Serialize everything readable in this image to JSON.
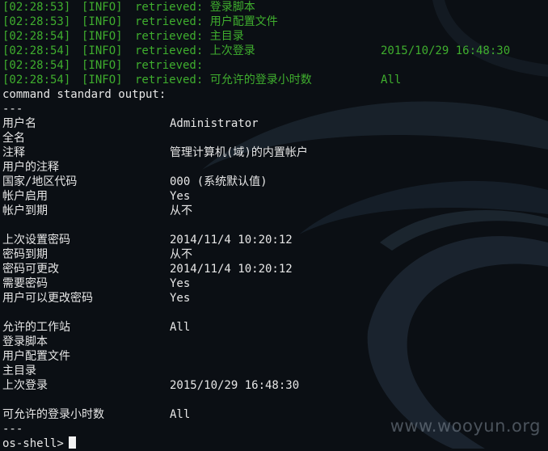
{
  "log_lines": [
    {
      "ts": "[02:28:53]",
      "level": "[INFO]",
      "msg": "retrieved: 登录脚本",
      "extra": ""
    },
    {
      "ts": "[02:28:53]",
      "level": "[INFO]",
      "msg": "retrieved: 用户配置文件",
      "extra": ""
    },
    {
      "ts": "[02:28:54]",
      "level": "[INFO]",
      "msg": "retrieved: 主目录",
      "extra": ""
    },
    {
      "ts": "[02:28:54]",
      "level": "[INFO]",
      "msg": "retrieved: 上次登录",
      "extra": "2015/10/29 16:48:30"
    },
    {
      "ts": "[02:28:54]",
      "level": "[INFO]",
      "msg": "retrieved:",
      "extra": ""
    },
    {
      "ts": "[02:28:54]",
      "level": "[INFO]",
      "msg": "retrieved: 可允许的登录小时数",
      "extra": "All"
    }
  ],
  "output_header": "command standard output:",
  "separator": "---",
  "rows": [
    {
      "key": "用户名",
      "value": "Administrator"
    },
    {
      "key": "全名",
      "value": ""
    },
    {
      "key": "注释",
      "value": "管理计算机(域)的内置帐户"
    },
    {
      "key": "用户的注释",
      "value": ""
    },
    {
      "key": "国家/地区代码",
      "value": "000 (系统默认值)"
    },
    {
      "key": "帐户启用",
      "value": "Yes"
    },
    {
      "key": "帐户到期",
      "value": "从不"
    },
    {
      "key": "",
      "value": ""
    },
    {
      "key": "上次设置密码",
      "value": "2014/11/4 10:20:12"
    },
    {
      "key": "密码到期",
      "value": "从不"
    },
    {
      "key": "密码可更改",
      "value": "2014/11/4 10:20:12"
    },
    {
      "key": "需要密码",
      "value": "Yes"
    },
    {
      "key": "用户可以更改密码",
      "value": "Yes"
    },
    {
      "key": "",
      "value": ""
    },
    {
      "key": "允许的工作站",
      "value": "All"
    },
    {
      "key": "登录脚本",
      "value": ""
    },
    {
      "key": "用户配置文件",
      "value": ""
    },
    {
      "key": "主目录",
      "value": ""
    },
    {
      "key": "上次登录",
      "value": "2015/10/29 16:48:30"
    },
    {
      "key": "",
      "value": ""
    },
    {
      "key": "可允许的登录小时数",
      "value": "All"
    }
  ],
  "end_separator": "---",
  "prompt": "os-shell>",
  "watermark": "www.wooyun.org",
  "colors": {
    "background": "#0b0f14",
    "log_text": "#3fae2e",
    "output_text": "#e7e7e7"
  }
}
